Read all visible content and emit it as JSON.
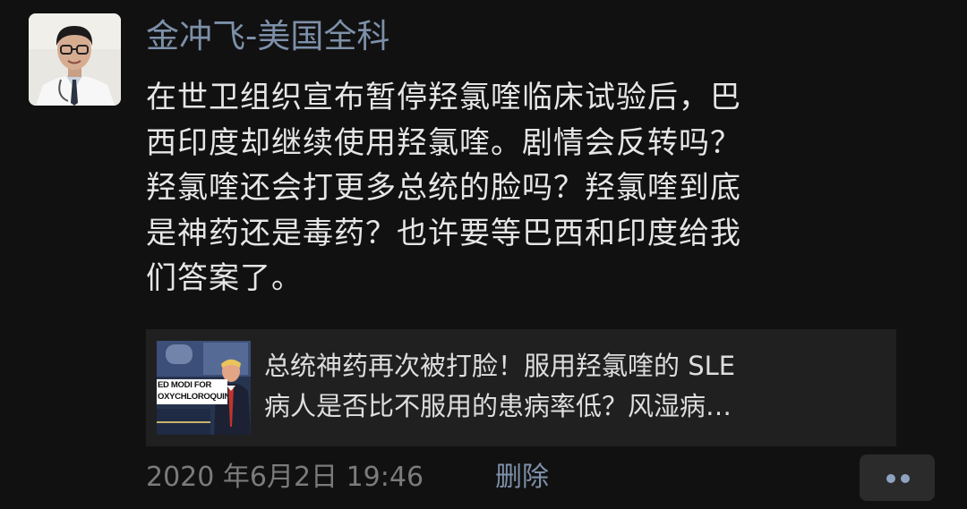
{
  "post": {
    "author_name": "金冲飞-美国全科",
    "avatar_icon": "profile-photo-doctor",
    "text_lines": [
      "在世卫组织宣布暂停羟氯喹临床试验后，巴",
      "西印度却继续使用羟氯喹。剧情会反转吗？",
      "羟氯喹还会打更多总统的脸吗？羟氯喹到底",
      "是神药还是毒药？也许要等巴西和印度给我",
      "们答案了。"
    ],
    "link_card": {
      "thumbnail_icon": "news-thumbnail-press-briefing",
      "thumbnail_caption_lines": [
        "ED MODI FOR",
        "OXYCHLOROQUINE"
      ],
      "title_lines": [
        "总统神药再次被打脸！服用羟氯喹的 SLE",
        "病人是否比不服用的患病率低？风湿病…"
      ]
    },
    "timestamp": "2020 年6月2日 19:46",
    "delete_label": "删除",
    "more_icon": "more-dots-icon"
  },
  "colors": {
    "background": "#111111",
    "name_link": "#7d90a9",
    "body_text": "#e6e6e6",
    "card_background": "#202020",
    "timestamp": "#7b7b7b",
    "more_button_bg": "#2b2b2b"
  }
}
